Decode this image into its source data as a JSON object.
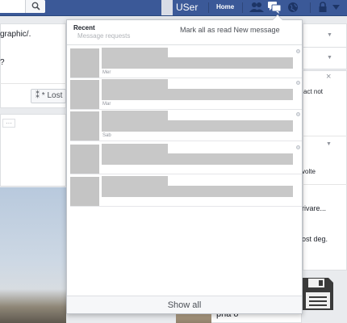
{
  "topbar": {
    "username": "USer",
    "home_label": "Home",
    "icons": [
      "search-icon",
      "friend-requests-icon",
      "messages-icon",
      "notifications-globe-icon",
      "privacy-lock-icon",
      "settings-caret-icon"
    ]
  },
  "background": {
    "url_fragment": "graphic/.",
    "question_mark": "?",
    "lost_button_label": "* Lost",
    "ellipsis": "···",
    "right_texts": [
      "act not",
      "volte",
      "rivare...",
      "ost deg."
    ],
    "bottom_text": "pha o",
    "close_symbol": "×"
  },
  "dropdown": {
    "recent_label": "Recent",
    "message_requests_label": "Message requests",
    "mark_all_read_label": "Mark all as read",
    "new_message_label": "New message",
    "show_all_label": "Show all",
    "messages": [
      {
        "time": "Mer"
      },
      {
        "time": "Mar"
      },
      {
        "time": "Sab"
      },
      {
        "time": ""
      },
      {
        "time": ""
      }
    ]
  },
  "colors": {
    "topbar_bg": "#3b5998",
    "page_bg": "#e9ebee",
    "redacted_gray": "#c8c8c8"
  }
}
